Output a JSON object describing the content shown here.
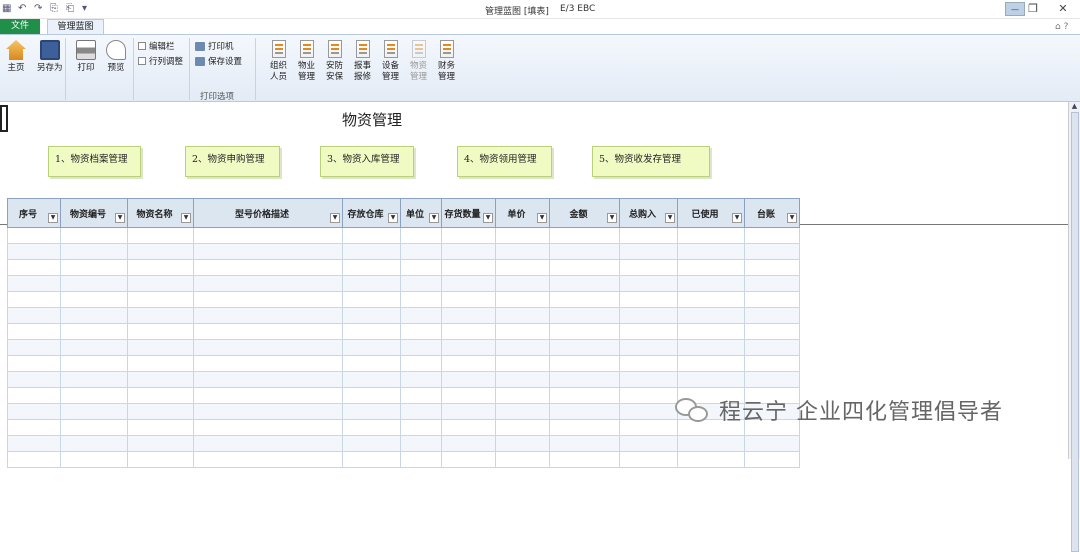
{
  "window": {
    "title": "管理蓝图 [填表]",
    "title_suffix": "E/3 EBC"
  },
  "tabs": {
    "file": "文件",
    "manage": "管理蓝图"
  },
  "ribbon": {
    "home": "主页",
    "save_as": "另存为",
    "print": "打印",
    "preview": "预览",
    "edit_bar": "编辑栏",
    "row_col_adjust": "行列调整",
    "printer": "打印机",
    "save_settings": "保存设置",
    "print_options_group": "打印选项",
    "modules": [
      {
        "l1": "组织",
        "l2": "人员",
        "enabled": true
      },
      {
        "l1": "物业",
        "l2": "管理",
        "enabled": true
      },
      {
        "l1": "安防",
        "l2": "安保",
        "enabled": true
      },
      {
        "l1": "报事",
        "l2": "报修",
        "enabled": true
      },
      {
        "l1": "设备",
        "l2": "管理",
        "enabled": true
      },
      {
        "l1": "物资",
        "l2": "管理",
        "enabled": false
      },
      {
        "l1": "财务",
        "l2": "管理",
        "enabled": true
      }
    ]
  },
  "sheet": {
    "title": "物资管理",
    "notes": [
      "1、物资档案管理",
      "2、物资申购管理",
      "3、物资入库管理",
      "4、物资领用管理",
      "5、物资收发存管理"
    ],
    "columns": [
      "序号",
      "物资编号",
      "物资名称",
      "型号价格描述",
      "存放仓库",
      "单位",
      "存货数量",
      "单价",
      "金额",
      "总购入",
      "已使用",
      "台账"
    ]
  },
  "watermark": "程云宁 企业四化管理倡导者",
  "colors": {
    "accent_green": "#1f8f4a",
    "header_blue": "#dce6f1",
    "note_yellow": "#f0fbc4"
  }
}
